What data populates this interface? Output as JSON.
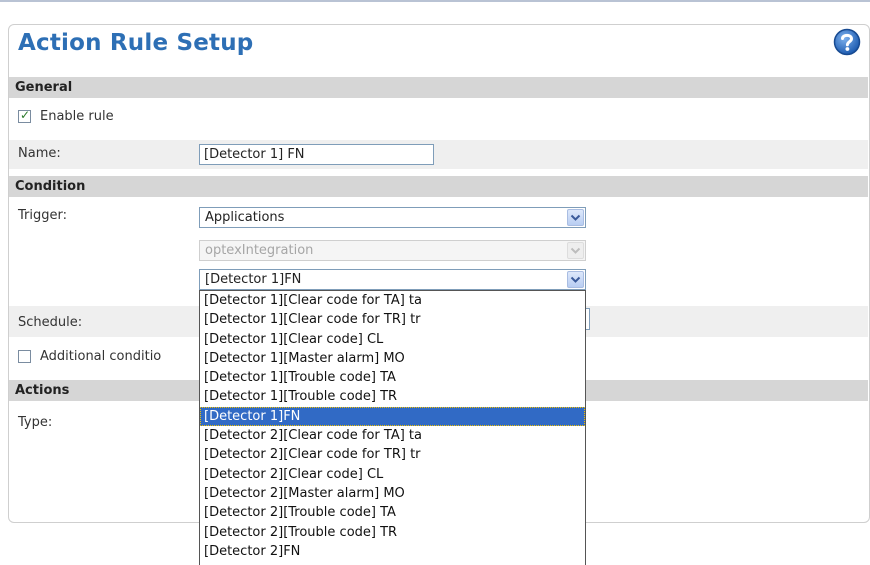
{
  "page": {
    "title": "Action Rule Setup",
    "help_icon": "help-icon"
  },
  "general": {
    "section_label": "General",
    "enable_rule_label": "Enable rule",
    "enable_rule_checked": true,
    "name_label": "Name:",
    "name_value": "[Detector 1] FN"
  },
  "condition": {
    "section_label": "Condition",
    "trigger_label": "Trigger:",
    "trigger_value": "Applications",
    "application_value": "optexIntegration",
    "event_value": "[Detector 1]FN",
    "schedule_label": "Schedule:",
    "additional_conditions_label": "Additional conditio",
    "additional_conditions_checked": false
  },
  "actions": {
    "section_label": "Actions",
    "type_label": "Type:"
  },
  "event_dropdown": {
    "options": [
      "[Detector 1][Clear code for TA] ta",
      "[Detector 1][Clear code for TR] tr",
      "[Detector 1][Clear code] CL",
      "[Detector 1][Master alarm] MO",
      "[Detector 1][Trouble code] TA",
      "[Detector 1][Trouble code] TR",
      "[Detector 1]FN",
      "[Detector 2][Clear code for TA] ta",
      "[Detector 2][Clear code for TR] tr",
      "[Detector 2][Clear code] CL",
      "[Detector 2][Master alarm] MO",
      "[Detector 2][Trouble code] TA",
      "[Detector 2][Trouble code] TR",
      "[Detector 2]FN"
    ],
    "selected_index": 6
  },
  "colors": {
    "title": "#2d6fb5",
    "section_bg": "#d6d6d6",
    "selection_bg": "#316ac5"
  }
}
